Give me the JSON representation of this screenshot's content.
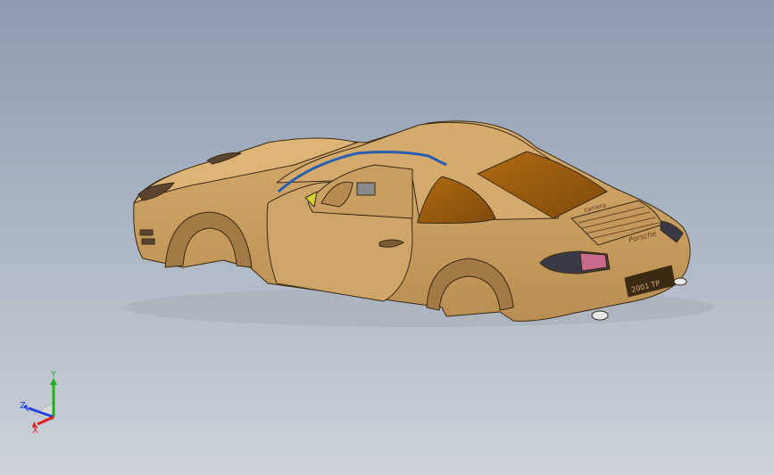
{
  "viewport": {
    "background_top": "#8d9cb0",
    "background_bottom": "#c9ced6",
    "model_color": "#c99f63",
    "model_shadow": "#8a6a3c",
    "glass_color": "#9a5a10",
    "edge_color": "#3a2a14"
  },
  "model": {
    "icon": "sports-car-body-model",
    "plate_text": "2001 TP",
    "badge_text": "Porsche",
    "grille_badge_text": "carrera"
  },
  "triad": {
    "x_label": "X",
    "y_label": "Y",
    "z_label": "Z",
    "x_color": "#e02020",
    "y_color": "#20b020",
    "z_color": "#2040e0"
  }
}
